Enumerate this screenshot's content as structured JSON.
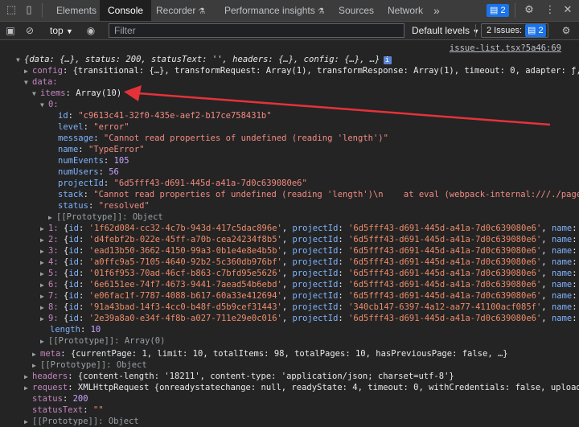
{
  "tabs": [
    "Elements",
    "Console",
    "Recorder",
    "Performance insights",
    "Sources",
    "Network"
  ],
  "tab_more": "»",
  "messages_count": "2",
  "toolbar": {
    "context": "top",
    "filter_placeholder": "Filter",
    "levels": "Default levels",
    "issues_label": "2 Issues:",
    "issues_count": "2"
  },
  "source_link": "issue-list.tsx?5a46:69",
  "log": {
    "summary": "{data: {…}, status: 200, statusText: '', headers: {…}, config: {…}, …}",
    "config": {
      "key": "config",
      "val": "{transitional: {…}, transformRequest: Array(1), transformResponse: Array(1), timeout: 0, adapter: ƒ, …}"
    },
    "data_key": "data:",
    "items": {
      "key": "items",
      "val": "Array(10)"
    },
    "item0_key": "0:",
    "item0": [
      {
        "k": "id",
        "v": "\"c9613c41-32f0-435e-aef2-b17ce758431b\"",
        "t": "str"
      },
      {
        "k": "level",
        "v": "\"error\"",
        "t": "str"
      },
      {
        "k": "message",
        "v": "\"Cannot read properties of undefined (reading 'length')\"",
        "t": "str"
      },
      {
        "k": "name",
        "v": "\"TypeError\"",
        "t": "str"
      },
      {
        "k": "numEvents",
        "v": "105",
        "t": "num"
      },
      {
        "k": "numUsers",
        "v": "56",
        "t": "num"
      },
      {
        "k": "projectId",
        "v": "\"6d5fff43-d691-445d-a41a-7d0c639080e6\"",
        "t": "str"
      },
      {
        "k": "stack",
        "v": "\"Cannot read properties of undefined (reading 'length')\\n    at eval (webpack-internal:///./pages/inc",
        "t": "str"
      },
      {
        "k": "status",
        "v": "\"resolved\"",
        "t": "str"
      }
    ],
    "proto_object": "[[Prototype]]: Object",
    "rows": [
      {
        "i": "1:",
        "id": "'1f62d084-cc32-4c7b-943d-417c5dac896e'",
        "pid": "'6d5fff43-d691-445d-a41a-7d0c639080e6'",
        "name": "'Type"
      },
      {
        "i": "2:",
        "id": "'d4febf2b-022e-45ff-a70b-cea24234f8b5'",
        "pid": "'6d5fff43-d691-445d-a41a-7d0c639080e6'",
        "name": "'Type"
      },
      {
        "i": "3:",
        "id": "'ead13b50-3662-4150-99a3-0b1e4e8e4b5b'",
        "pid": "'6d5fff43-d691-445d-a41a-7d0c639080e6'",
        "name": "'Type"
      },
      {
        "i": "4:",
        "id": "'a0ffc9a5-7105-4640-92b2-5c360db976bf'",
        "pid": "'6d5fff43-d691-445d-a41a-7d0c639080e6'",
        "name": "'Refe"
      },
      {
        "i": "5:",
        "id": "'01f6f953-70ad-46cf-b863-c7bfd95e5626'",
        "pid": "'6d5fff43-d691-445d-a41a-7d0c639080e6'",
        "name": "'Synt"
      },
      {
        "i": "6:",
        "id": "'6e6151ee-74f7-4673-9441-7aead54b6ebd'",
        "pid": "'6d5fff43-d691-445d-a41a-7d0c639080e6'",
        "name": "'Synt"
      },
      {
        "i": "7:",
        "id": "'e06fac1f-7787-4088-b617-60a33e412694'",
        "pid": "'6d5fff43-d691-445d-a41a-7d0c639080e6'",
        "name": "'Synt"
      },
      {
        "i": "8:",
        "id": "'91a43bad-14f3-4cc0-b48f-d5b9cef31443'",
        "pid": "'340cb147-6397-4a12-aa77-41100acf085f'",
        "name": "'Type"
      },
      {
        "i": "9:",
        "id": "'2e39a8a0-e34f-4f8b-a027-711e29e0c016'",
        "pid": "'6d5fff43-d691-445d-a41a-7d0c639080e6'",
        "name": "'Type"
      }
    ],
    "length": {
      "key": "length",
      "val": "10"
    },
    "proto_array": "[[Prototype]]: Array(0)",
    "meta": {
      "key": "meta",
      "val": "{currentPage: 1, limit: 10, totalItems: 98, totalPages: 10, hasPreviousPage: false, …}"
    },
    "headers": {
      "key": "headers",
      "val": "{content-length: '18211', content-type: 'application/json; charset=utf-8'}"
    },
    "request": {
      "key": "request",
      "val": "XMLHttpRequest {onreadystatechange: null, readyState: 4, timeout: 0, withCredentials: false, upload: XML"
    },
    "status": {
      "key": "status",
      "val": "200"
    },
    "statusText": {
      "key": "statusText",
      "val": "\"\""
    },
    "proto_object2": "[[Prototype]]: Object"
  },
  "annotation": {
    "color": "#e5323a"
  }
}
